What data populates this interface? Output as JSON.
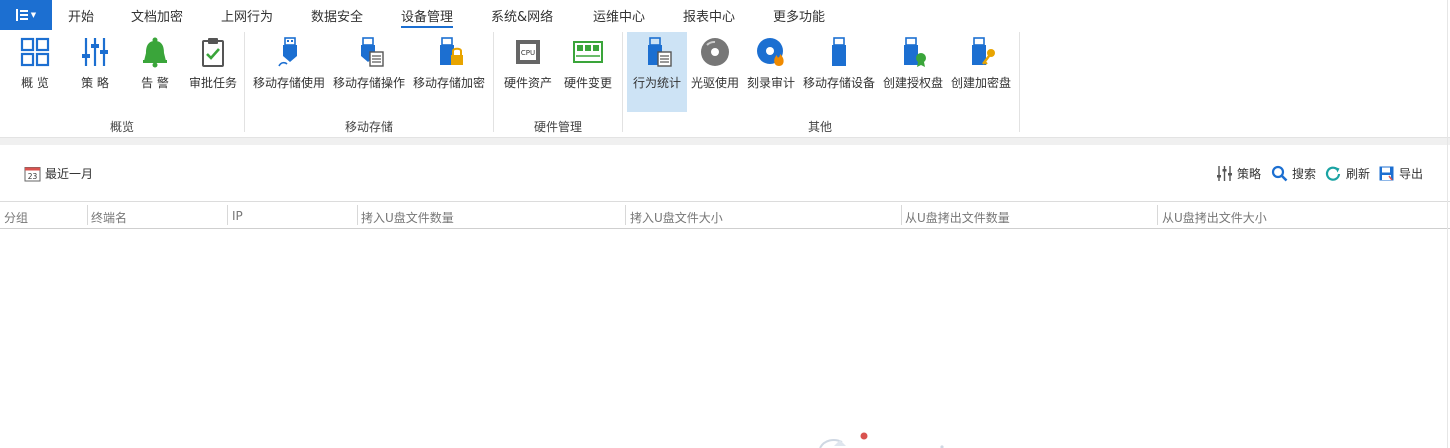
{
  "menu": {
    "tabs": [
      "开始",
      "文档加密",
      "上网行为",
      "数据安全",
      "设备管理",
      "系统&网络",
      "运维中心",
      "报表中心",
      "更多功能"
    ],
    "active": "设备管理"
  },
  "ribbon": {
    "groups": {
      "overview": "概览",
      "mobile_storage": "移动存储",
      "hardware": "硬件管理",
      "other": "其他"
    },
    "buttons": {
      "overview": "概 览",
      "policy": "策 略",
      "alert": "告 警",
      "approval": "审批任务",
      "storage_use": "移动存储使用",
      "storage_op": "移动存储操作",
      "storage_encrypt": "移动存储加密",
      "hw_assets": "硬件资产",
      "hw_change": "硬件变更",
      "behavior_stats": "行为统计",
      "optical_use": "光驱使用",
      "burn_audit": "刻录审计",
      "storage_device": "移动存储设备",
      "create_auth_disk": "创建授权盘",
      "create_encrypt_disk": "创建加密盘"
    }
  },
  "toolbar": {
    "date_range": "最近一月",
    "calendar_day": "23",
    "policy": "策略",
    "search": "搜索",
    "refresh": "刷新",
    "export": "导出"
  },
  "table": {
    "columns": [
      "分组",
      "终端名",
      "IP",
      "拷入U盘文件数量",
      "拷入U盘文件大小",
      "从U盘拷出文件数量",
      "从U盘拷出文件大小"
    ]
  },
  "colors": {
    "accent": "#1c6fd1",
    "active_bg": "#cde3f5",
    "green": "#3aa53a"
  }
}
